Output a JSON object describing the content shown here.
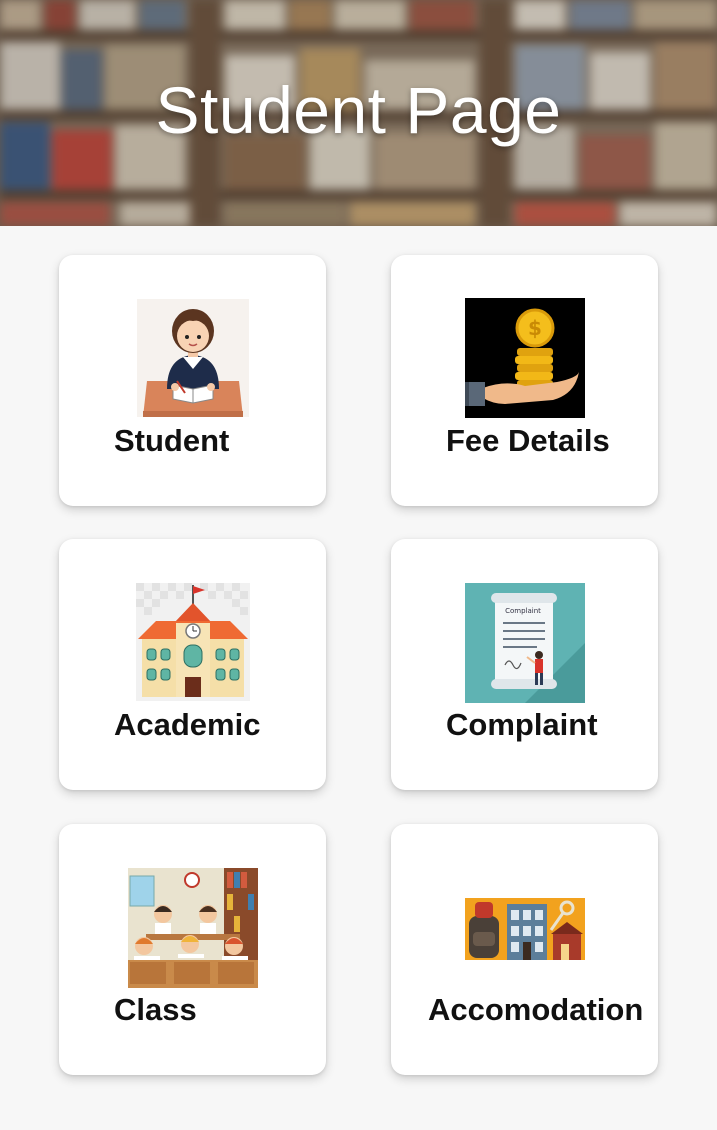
{
  "header": {
    "title": "Student Page"
  },
  "cards": [
    {
      "label": "Student"
    },
    {
      "label": "Fee Details"
    },
    {
      "label": "Academic"
    },
    {
      "label": "Complaint"
    },
    {
      "label": "Class"
    },
    {
      "label": "Accomodation"
    }
  ],
  "illustrations": {
    "complaint_doc_title": "Complaint",
    "coin_symbol": "$"
  },
  "colors": {
    "page_bg": "#f7f7f7",
    "card_bg": "#ffffff",
    "label_text": "#111111",
    "title_text": "#ffffff"
  },
  "icons": [
    "student-girl-reading-image",
    "coins-in-hand-image",
    "school-building-image",
    "complaint-document-image",
    "classroom-kids-image",
    "accommodation-buildings-image"
  ]
}
